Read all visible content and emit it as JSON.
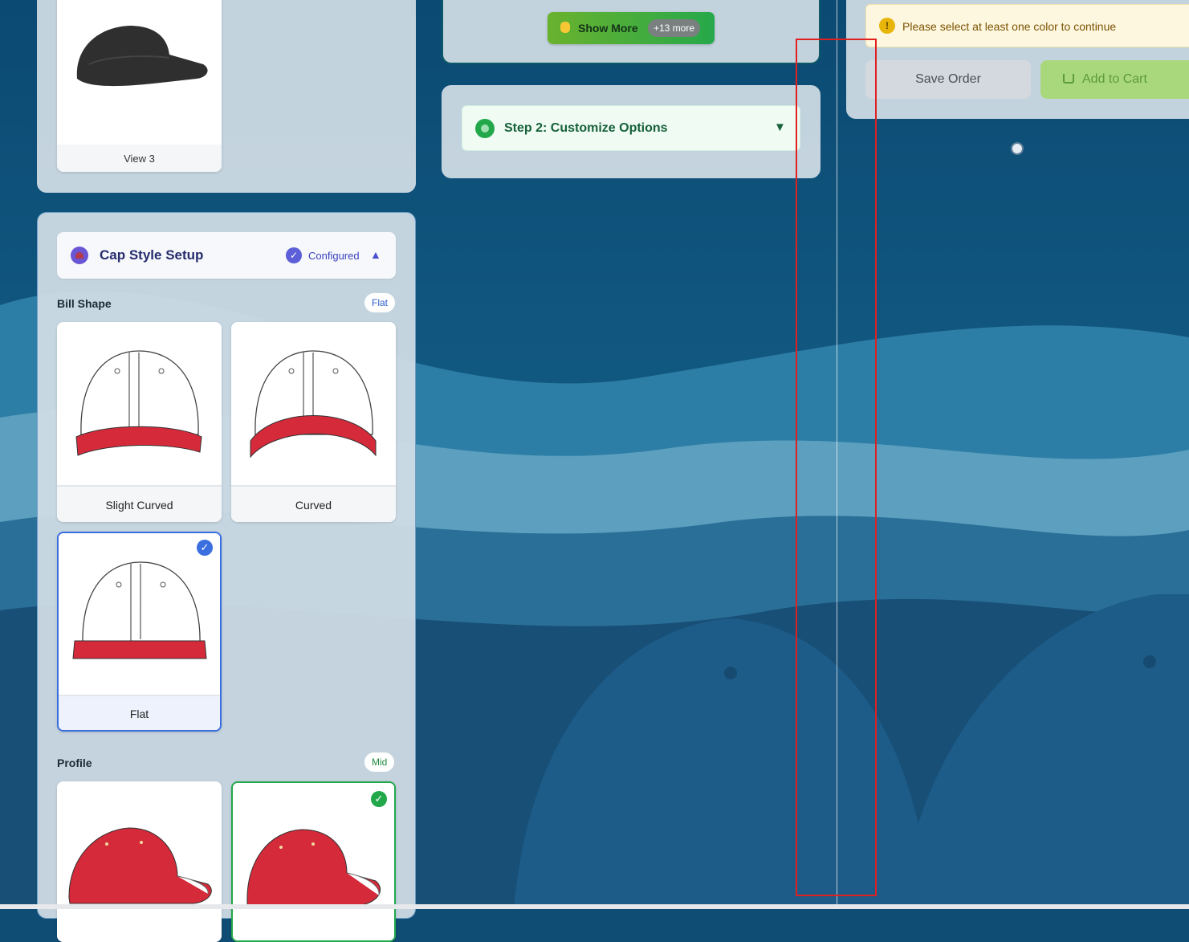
{
  "left_panel": {
    "view_card": {
      "label": "View 3"
    },
    "cap_style": {
      "title": "Cap Style Setup",
      "status": "Configured",
      "bill_shape": {
        "title": "Bill Shape",
        "selected_badge": "Flat",
        "options": [
          {
            "label": "Slight Curved",
            "selected": false
          },
          {
            "label": "Curved",
            "selected": false
          },
          {
            "label": "Flat",
            "selected": true
          }
        ]
      },
      "profile": {
        "title": "Profile",
        "selected_badge": "Mid"
      }
    }
  },
  "middle_panel": {
    "show_more": {
      "label": "Show More",
      "count": "+13 more",
      "icon": "pointing-hand-icon"
    },
    "step2": {
      "label": "Step 2: Customize Options",
      "icon": "gear-icon"
    }
  },
  "right_panel": {
    "alert": {
      "text": "Please select at least one color to continue",
      "icon": "warning-icon"
    },
    "save_order": "Save Order",
    "add_to_cart": "Add to Cart"
  },
  "colors": {
    "accent_blue": "#3b6fe0",
    "accent_green": "#22a84a",
    "cap_red": "#d42a3a",
    "warning_bg": "#fef7e0",
    "warning_text": "#7a5200"
  }
}
